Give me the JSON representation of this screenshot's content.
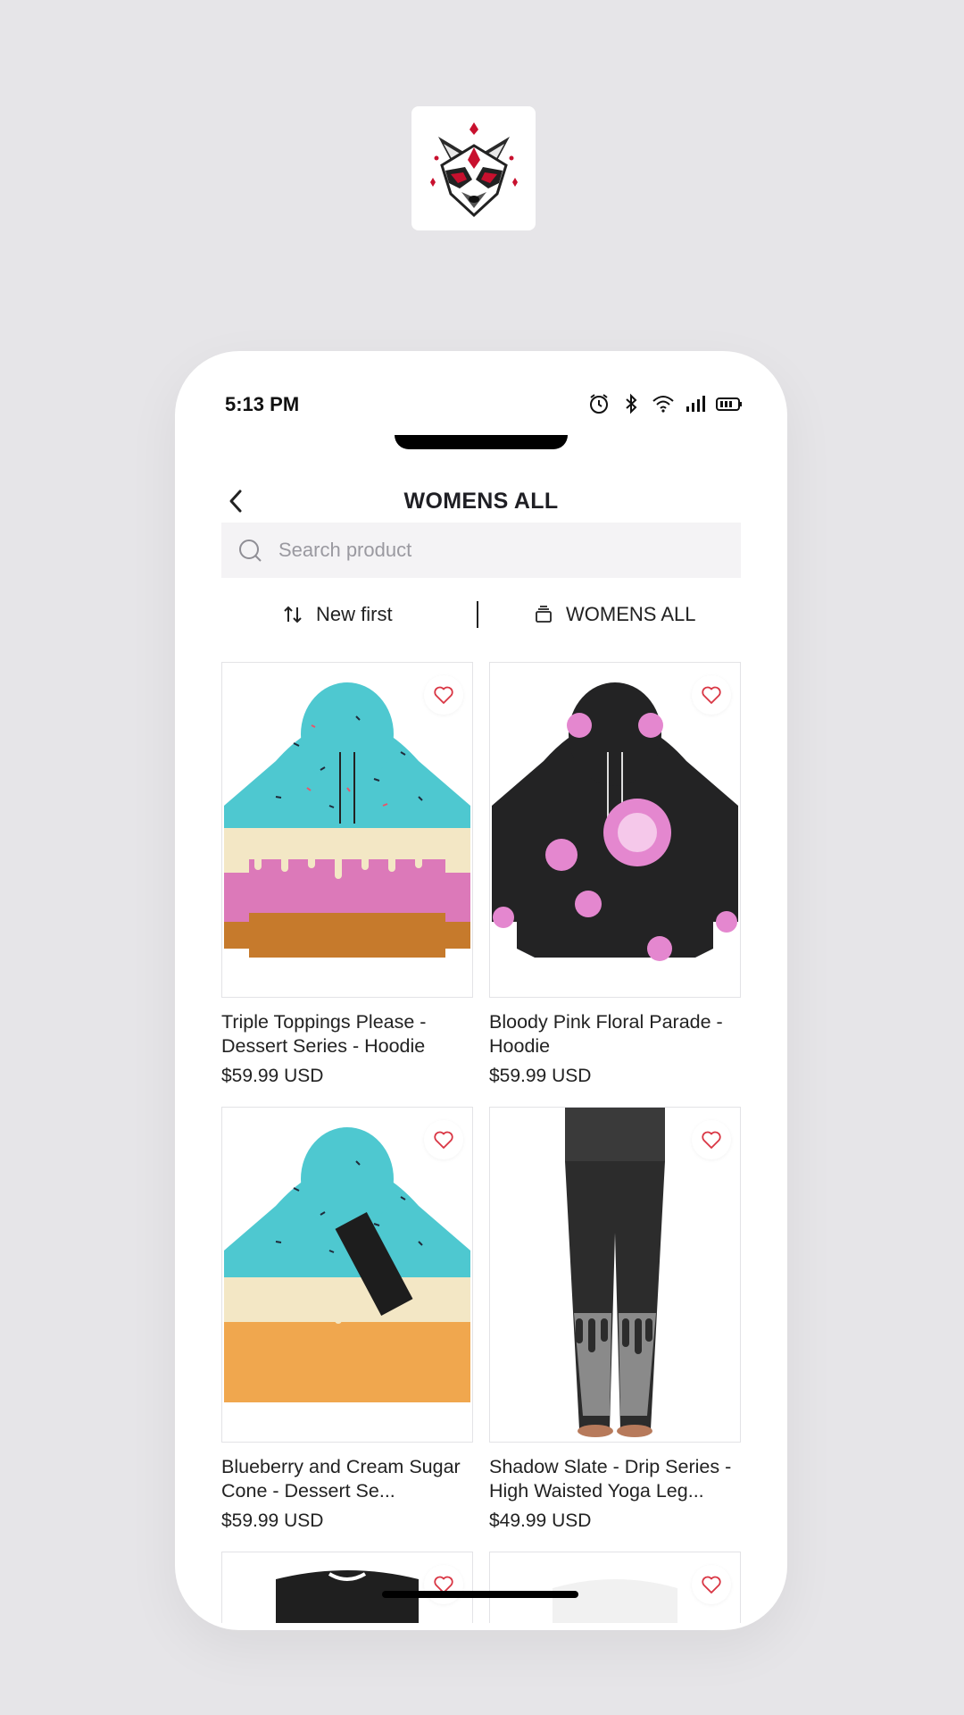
{
  "status_bar": {
    "time": "5:13 PM"
  },
  "header": {
    "title": "WOMENS ALL"
  },
  "search": {
    "placeholder": "Search product"
  },
  "filters": {
    "sort_label": "New first",
    "category_label": "WOMENS ALL"
  },
  "products": [
    {
      "title": "Triple Toppings Please - Dessert Series - Hoodie",
      "price": "$59.99 USD"
    },
    {
      "title": "Bloody Pink Floral Parade - Hoodie",
      "price": "$59.99 USD"
    },
    {
      "title": "Blueberry and Cream Sugar Cone - Dessert Se...",
      "price": "$59.99 USD"
    },
    {
      "title": "Shadow Slate - Drip Series - High Waisted Yoga Leg...",
      "price": "$49.99 USD"
    }
  ],
  "colors": {
    "accent": "#d93644",
    "background": "#e6e5e8",
    "search_bg": "#f4f3f5"
  },
  "icons": [
    "raccoon-logo",
    "back-arrow-icon",
    "search-icon",
    "sort-icon",
    "category-icon",
    "heart-icon",
    "alarm-icon",
    "bluetooth-icon",
    "wifi-icon",
    "signal-icon",
    "battery-icon"
  ]
}
